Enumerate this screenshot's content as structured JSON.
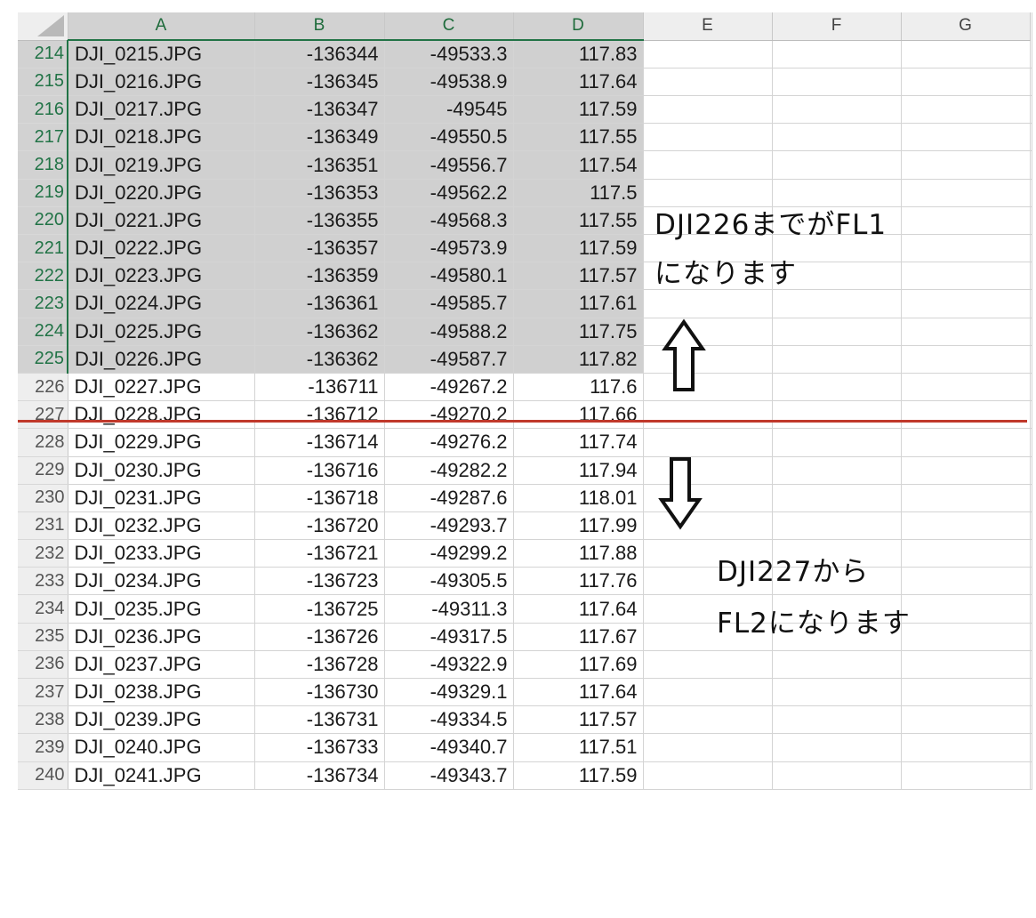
{
  "columns": [
    "A",
    "B",
    "C",
    "D",
    "E",
    "F",
    "G"
  ],
  "rows": [
    {
      "num": "214",
      "a": "DJI_0215.JPG",
      "b": "-136344",
      "c": "-49533.3",
      "d": "117.83"
    },
    {
      "num": "215",
      "a": "DJI_0216.JPG",
      "b": "-136345",
      "c": "-49538.9",
      "d": "117.64"
    },
    {
      "num": "216",
      "a": "DJI_0217.JPG",
      "b": "-136347",
      "c": "-49545",
      "d": "117.59"
    },
    {
      "num": "217",
      "a": "DJI_0218.JPG",
      "b": "-136349",
      "c": "-49550.5",
      "d": "117.55"
    },
    {
      "num": "218",
      "a": "DJI_0219.JPG",
      "b": "-136351",
      "c": "-49556.7",
      "d": "117.54"
    },
    {
      "num": "219",
      "a": "DJI_0220.JPG",
      "b": "-136353",
      "c": "-49562.2",
      "d": "117.5"
    },
    {
      "num": "220",
      "a": "DJI_0221.JPG",
      "b": "-136355",
      "c": "-49568.3",
      "d": "117.55"
    },
    {
      "num": "221",
      "a": "DJI_0222.JPG",
      "b": "-136357",
      "c": "-49573.9",
      "d": "117.59"
    },
    {
      "num": "222",
      "a": "DJI_0223.JPG",
      "b": "-136359",
      "c": "-49580.1",
      "d": "117.57"
    },
    {
      "num": "223",
      "a": "DJI_0224.JPG",
      "b": "-136361",
      "c": "-49585.7",
      "d": "117.61"
    },
    {
      "num": "224",
      "a": "DJI_0225.JPG",
      "b": "-136362",
      "c": "-49588.2",
      "d": "117.75"
    },
    {
      "num": "225",
      "a": "DJI_0226.JPG",
      "b": "-136362",
      "c": "-49587.7",
      "d": "117.82"
    },
    {
      "num": "226",
      "a": "DJI_0227.JPG",
      "b": "-136711",
      "c": "-49267.2",
      "d": "117.6"
    },
    {
      "num": "227",
      "a": "DJI_0228.JPG",
      "b": "-136712",
      "c": "-49270.2",
      "d": "117.66"
    },
    {
      "num": "228",
      "a": "DJI_0229.JPG",
      "b": "-136714",
      "c": "-49276.2",
      "d": "117.74"
    },
    {
      "num": "229",
      "a": "DJI_0230.JPG",
      "b": "-136716",
      "c": "-49282.2",
      "d": "117.94"
    },
    {
      "num": "230",
      "a": "DJI_0231.JPG",
      "b": "-136718",
      "c": "-49287.6",
      "d": "118.01"
    },
    {
      "num": "231",
      "a": "DJI_0232.JPG",
      "b": "-136720",
      "c": "-49293.7",
      "d": "117.99"
    },
    {
      "num": "232",
      "a": "DJI_0233.JPG",
      "b": "-136721",
      "c": "-49299.2",
      "d": "117.88"
    },
    {
      "num": "233",
      "a": "DJI_0234.JPG",
      "b": "-136723",
      "c": "-49305.5",
      "d": "117.76"
    },
    {
      "num": "234",
      "a": "DJI_0235.JPG",
      "b": "-136725",
      "c": "-49311.3",
      "d": "117.64"
    },
    {
      "num": "235",
      "a": "DJI_0236.JPG",
      "b": "-136726",
      "c": "-49317.5",
      "d": "117.67"
    },
    {
      "num": "236",
      "a": "DJI_0237.JPG",
      "b": "-136728",
      "c": "-49322.9",
      "d": "117.69"
    },
    {
      "num": "237",
      "a": "DJI_0238.JPG",
      "b": "-136730",
      "c": "-49329.1",
      "d": "117.64"
    },
    {
      "num": "238",
      "a": "DJI_0239.JPG",
      "b": "-136731",
      "c": "-49334.5",
      "d": "117.57"
    },
    {
      "num": "239",
      "a": "DJI_0240.JPG",
      "b": "-136733",
      "c": "-49340.7",
      "d": "117.51"
    },
    {
      "num": "240",
      "a": "DJI_0241.JPG",
      "b": "-136734",
      "c": "-49343.7",
      "d": "117.59"
    }
  ],
  "selection": {
    "first_row": "214",
    "last_row": "225",
    "columns": [
      "A",
      "B",
      "C",
      "D"
    ]
  },
  "annotations": {
    "fl1_line1": "DJI226までがFL1",
    "fl1_line2": "になります",
    "fl2_line1": "DJI227から",
    "fl2_line2": "FL2になります",
    "up_arrow_icon": "outline-up-arrow-icon",
    "down_arrow_icon": "outline-down-arrow-icon"
  },
  "colors": {
    "selection_accent": "#217346",
    "divider_line": "#c0392b",
    "selection_fill": "#d0d0d0"
  }
}
